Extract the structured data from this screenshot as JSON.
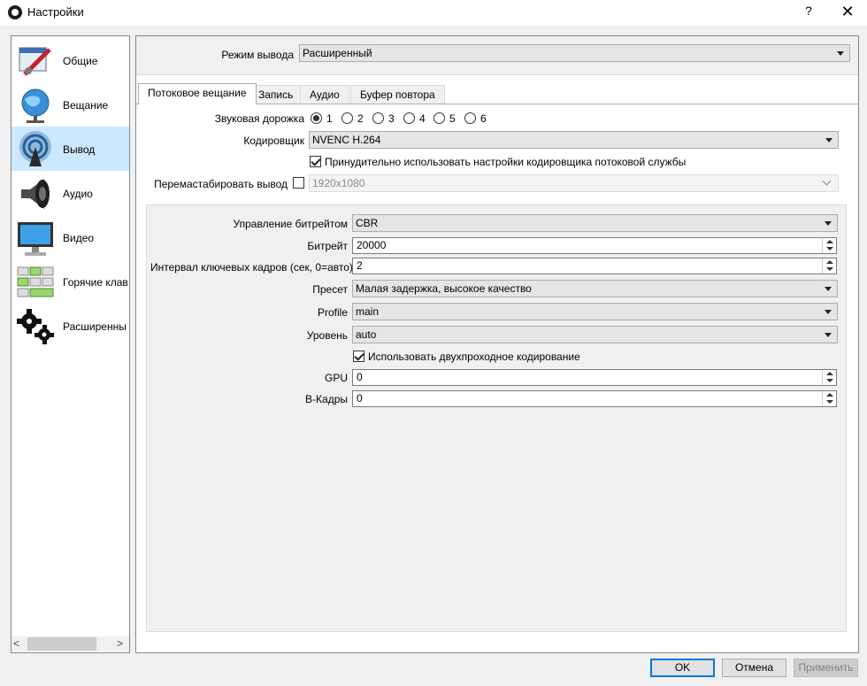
{
  "window": {
    "title": "Настройки",
    "help_label": "?",
    "close_label": "✕"
  },
  "sidebar": {
    "items": [
      {
        "label": "Общие",
        "icon": "general-icon",
        "selected": false
      },
      {
        "label": "Вещание",
        "icon": "broadcast-globe-icon",
        "selected": false
      },
      {
        "label": "Вывод",
        "icon": "output-antenna-icon",
        "selected": true
      },
      {
        "label": "Аудио",
        "icon": "speaker-icon",
        "selected": false
      },
      {
        "label": "Видео",
        "icon": "monitor-icon",
        "selected": false
      },
      {
        "label": "Горячие клав",
        "icon": "keyboard-icon",
        "selected": false
      },
      {
        "label": "Расширенны",
        "icon": "gears-icon",
        "selected": false
      }
    ],
    "scroll_left": "<",
    "scroll_right": ">"
  },
  "output": {
    "mode_label": "Режим вывода",
    "mode_value": "Расширенный",
    "tabs": [
      {
        "label": "Потоковое вещание",
        "active": true
      },
      {
        "label": "Запись",
        "active": false
      },
      {
        "label": "Аудио",
        "active": false
      },
      {
        "label": "Буфер повтора",
        "active": false
      }
    ],
    "audio_track_label": "Звуковая дорожка",
    "audio_tracks": [
      "1",
      "2",
      "3",
      "4",
      "5",
      "6"
    ],
    "audio_track_selected": "1",
    "encoder_label": "Кодировщик",
    "encoder_value": "NVENC H.264",
    "enforce_label": "Принудительно использовать настройки кодировщика потоковой службы",
    "enforce_checked": true,
    "rescale_label": "Перемастабировать вывод",
    "rescale_checked": false,
    "rescale_value": "1920x1080"
  },
  "encoder": {
    "rate_control_label": "Управление битрейтом",
    "rate_control_value": "CBR",
    "bitrate_label": "Битрейт",
    "bitrate_value": "20000",
    "keyint_label": "Интервал ключевых кадров (сек, 0=авто)",
    "keyint_value": "2",
    "preset_label": "Пресет",
    "preset_value": "Малая задержка, высокое качество",
    "profile_label": "Profile",
    "profile_value": "main",
    "level_label": "Уровень",
    "level_value": "auto",
    "twopass_label": "Использовать двухпроходное кодирование",
    "twopass_checked": true,
    "gpu_label": "GPU",
    "gpu_value": "0",
    "bframes_label": "В-Кадры",
    "bframes_value": "0"
  },
  "buttons": {
    "ok": "OK",
    "cancel": "Отмена",
    "apply": "Применить"
  }
}
